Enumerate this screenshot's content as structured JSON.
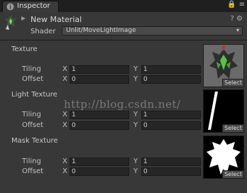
{
  "tab": {
    "label": "Inspector",
    "icon": "info-icon"
  },
  "window_controls": {
    "lock_icon": "lock-icon",
    "menu_icon": "menu-icon",
    "lock_glyph": "🔒",
    "menu_glyph": "≡"
  },
  "header": {
    "material_name": "New Material",
    "shader_label": "Shader",
    "shader_value": "Unlit/MoveLightImage",
    "help_glyph": "?",
    "settings_glyph": "⚙"
  },
  "properties": [
    {
      "title": "Texture",
      "tiling_label": "Tiling",
      "offset_label": "Offset",
      "tiling": {
        "x": "1",
        "y": "1"
      },
      "offset": {
        "x": "0",
        "y": "0"
      },
      "select_label": "Select"
    },
    {
      "title": "Light Texture",
      "tiling_label": "Tiling",
      "offset_label": "Offset",
      "tiling": {
        "x": "1",
        "y": "1"
      },
      "offset": {
        "x": "0",
        "y": "0"
      },
      "select_label": "Select"
    },
    {
      "title": "Mask Texture",
      "tiling_label": "Tiling",
      "offset_label": "Offset",
      "tiling": {
        "x": "1",
        "y": "1"
      },
      "offset": {
        "x": "0",
        "y": "0"
      },
      "select_label": "Select"
    }
  ],
  "axis_labels": {
    "x": "X",
    "y": "Y"
  },
  "watermark": "http://blog.csdn.net/",
  "colors": {
    "accent": "#3a3a3a",
    "field_bg": "#262626",
    "panel_bg": "#383838"
  }
}
